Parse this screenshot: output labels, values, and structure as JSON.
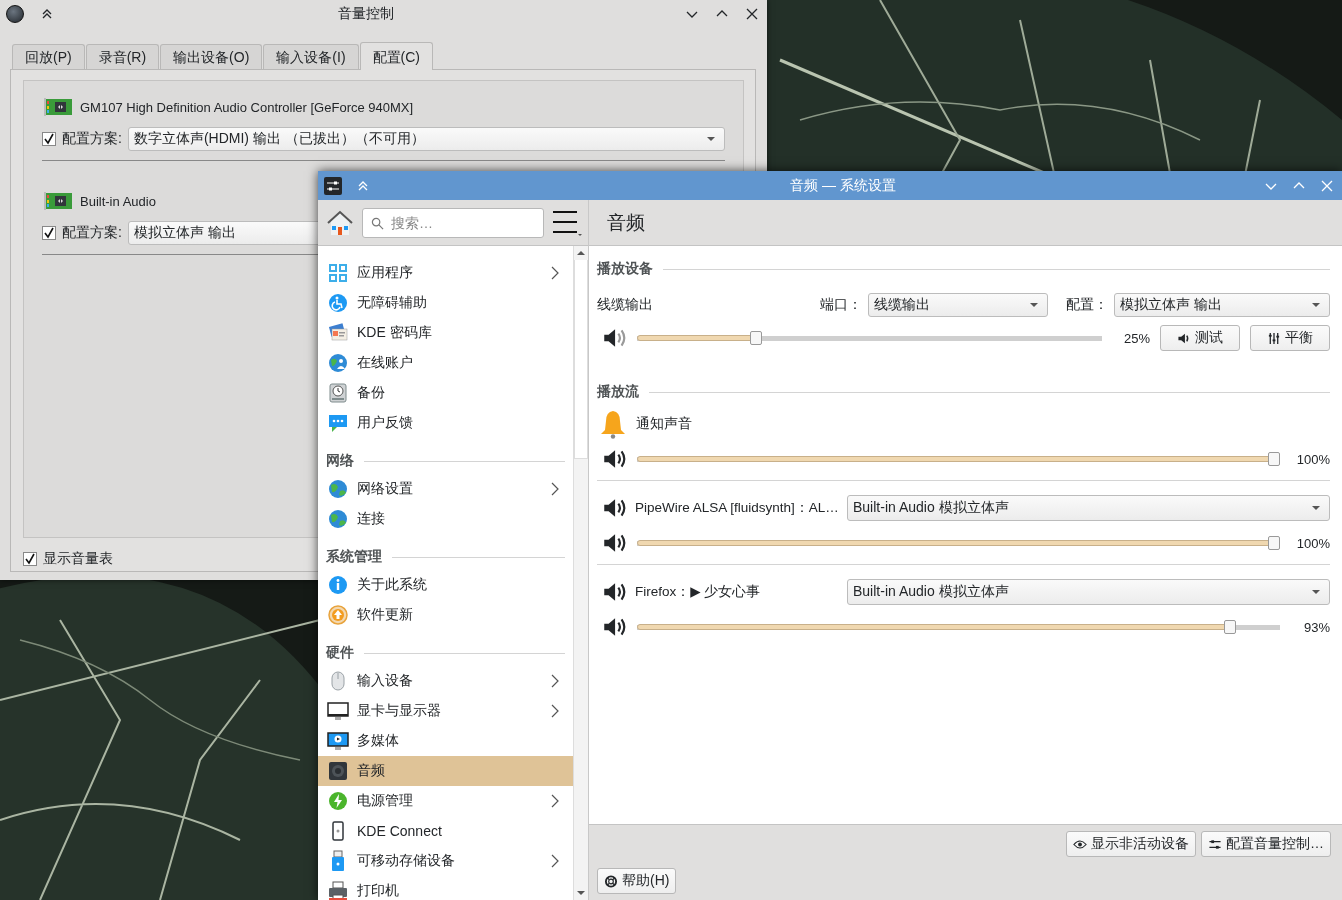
{
  "mixer_window": {
    "title": "音量控制",
    "tabs": [
      {
        "label": "回放(P)",
        "selected": false
      },
      {
        "label": "录音(R)",
        "selected": false
      },
      {
        "label": "输出设备(O)",
        "selected": false
      },
      {
        "label": "输入设备(I)",
        "selected": false
      },
      {
        "label": "配置(C)",
        "selected": true
      }
    ],
    "cards": [
      {
        "device": "GM107 High Definition Audio Controller [GeForce 940MX]",
        "profile_checked": true,
        "profile_label": "配置方案:",
        "profile": "数字立体声(HDMI) 输出 （已拔出）（不可用）"
      },
      {
        "device": "Built-in Audio",
        "profile_checked": true,
        "profile_label": "配置方案:",
        "profile": "模拟立体声 输出"
      }
    ],
    "show_meters": {
      "label": "显示音量表",
      "checked": true
    }
  },
  "settings_window": {
    "title": "音频 — 系统设置",
    "search": {
      "placeholder": "搜索…"
    },
    "sidebar": {
      "sections": [
        {
          "items": [
            {
              "label": "应用程序",
              "selected": false,
              "has_children": true
            },
            {
              "label": "无障碍辅助",
              "selected": false,
              "has_children": false
            },
            {
              "label": "KDE 密码库",
              "selected": false,
              "has_children": false
            },
            {
              "label": "在线账户",
              "selected": false,
              "has_children": false
            },
            {
              "label": "备份",
              "selected": false,
              "has_children": false
            },
            {
              "label": "用户反馈",
              "selected": false,
              "has_children": false
            }
          ]
        },
        {
          "title": "网络",
          "items": [
            {
              "label": "网络设置",
              "selected": false,
              "has_children": true
            },
            {
              "label": "连接",
              "selected": false,
              "has_children": false
            }
          ]
        },
        {
          "title": "系统管理",
          "items": [
            {
              "label": "关于此系统",
              "selected": false,
              "has_children": false
            },
            {
              "label": "软件更新",
              "selected": false,
              "has_children": false
            }
          ]
        },
        {
          "title": "硬件",
          "items": [
            {
              "label": "输入设备",
              "selected": false,
              "has_children": true
            },
            {
              "label": "显卡与显示器",
              "selected": false,
              "has_children": true
            },
            {
              "label": "多媒体",
              "selected": false,
              "has_children": false
            },
            {
              "label": "音频",
              "selected": true,
              "has_children": false
            },
            {
              "label": "电源管理",
              "selected": false,
              "has_children": true
            },
            {
              "label": "KDE Connect",
              "selected": false,
              "has_children": false
            },
            {
              "label": "可移动存储设备",
              "selected": false,
              "has_children": true
            },
            {
              "label": "打印机",
              "selected": false,
              "has_children": false
            }
          ]
        }
      ]
    },
    "page_title": "音频",
    "playback_devices": {
      "title": "播放设备",
      "devices": [
        {
          "name": "线缆输出",
          "port_label": "端口：",
          "port": "线缆输出",
          "profile_label": "配置：",
          "profile": "模拟立体声 输出",
          "level": 0.25,
          "reading": "25%",
          "buttons": [
            "测试",
            "平衡"
          ]
        }
      ]
    },
    "playback_streams": {
      "title": "播放流",
      "streams": [
        {
          "kind": "notification",
          "name": "通知声音",
          "level": 1,
          "reading": "100%"
        },
        {
          "kind": "application",
          "name": "PipeWire ALSA [fluidsynth]：AL…",
          "device": "Built-in Audio 模拟立体声",
          "level": 1,
          "reading": "100%"
        },
        {
          "kind": "application",
          "name": "Firefox：▶ 少女心事",
          "device": "Built-in Audio 模拟立体声",
          "level": 0.93,
          "reading": "93%"
        }
      ]
    },
    "footer_buttons": [
      "显示非活动设备",
      "配置音量控制…"
    ],
    "help_button": "帮助(H)"
  }
}
